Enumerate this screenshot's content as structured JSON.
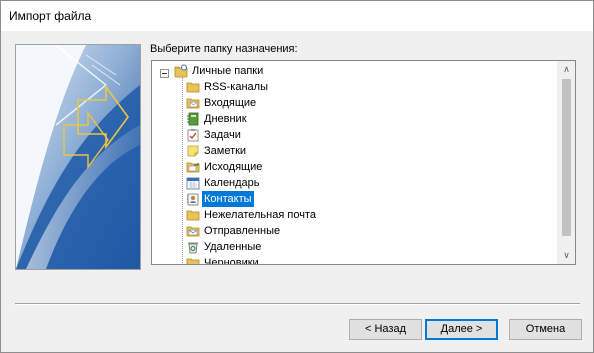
{
  "window": {
    "title": "Импорт файла"
  },
  "prompt": "Выберите папку назначения:",
  "tree": {
    "root": {
      "label": "Личные папки",
      "icon": "personal-folders-icon"
    },
    "items": [
      {
        "label": "RSS-каналы",
        "icon": "folder-icon",
        "selected": false
      },
      {
        "label": "Входящие",
        "icon": "inbox-icon",
        "selected": false
      },
      {
        "label": "Дневник",
        "icon": "journal-icon",
        "selected": false
      },
      {
        "label": "Задачи",
        "icon": "tasks-icon",
        "selected": false
      },
      {
        "label": "Заметки",
        "icon": "notes-icon",
        "selected": false
      },
      {
        "label": "Исходящие",
        "icon": "outbox-icon",
        "selected": false
      },
      {
        "label": "Календарь",
        "icon": "calendar-icon",
        "selected": false
      },
      {
        "label": "Контакты",
        "icon": "contacts-icon",
        "selected": true
      },
      {
        "label": "Нежелательная почта",
        "icon": "folder-icon",
        "selected": false
      },
      {
        "label": "Отправленные",
        "icon": "sent-items-icon",
        "selected": false
      },
      {
        "label": "Удаленные",
        "icon": "deleted-items-icon",
        "selected": false
      },
      {
        "label": "Черновики",
        "icon": "drafts-icon",
        "selected": false
      }
    ]
  },
  "buttons": {
    "back": "< Назад",
    "next": "Далее >",
    "cancel": "Отмена"
  },
  "colors": {
    "selection": "#0078d7",
    "folder": "#e8c25a"
  }
}
